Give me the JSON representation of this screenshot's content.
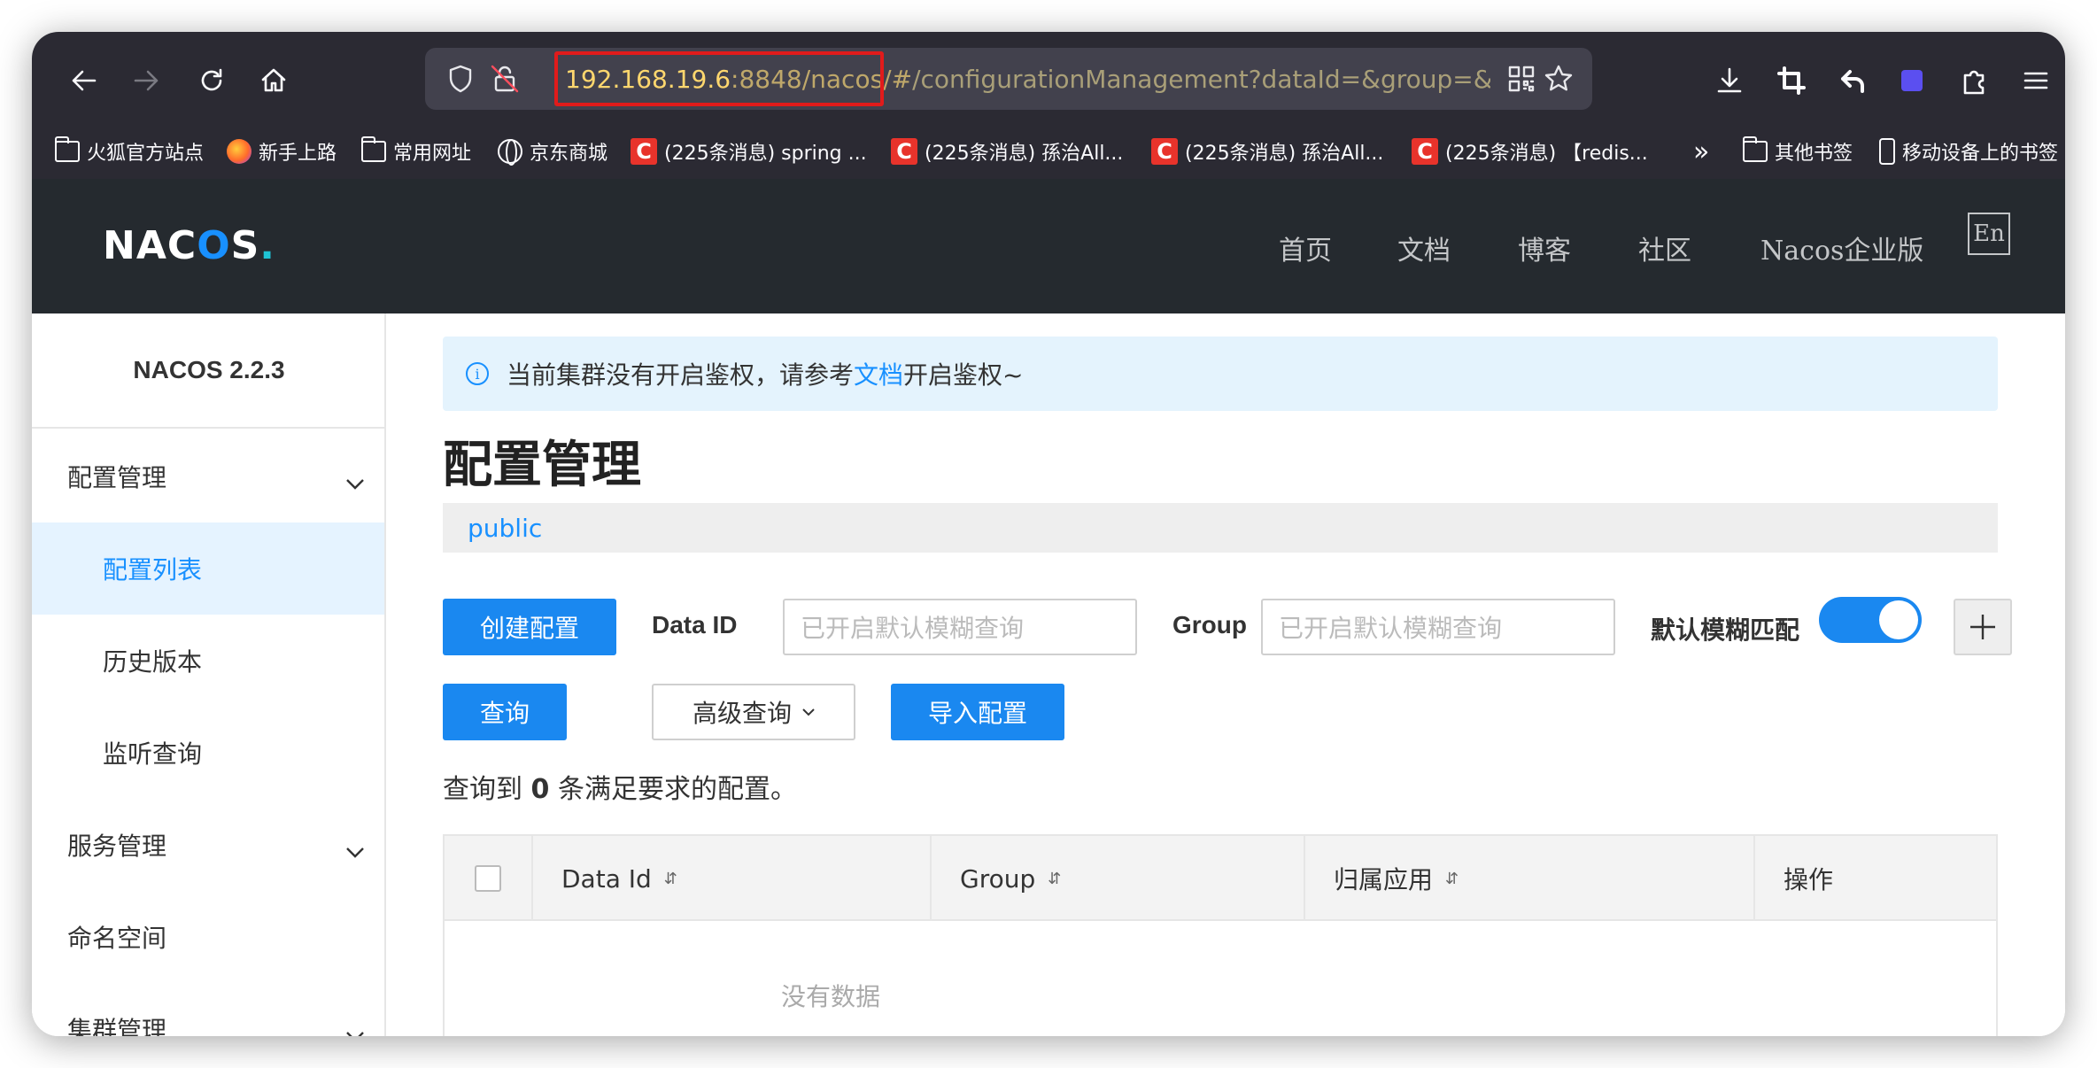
{
  "browser": {
    "url_host": "192.168.19.6",
    "url_port_path": ":8848/nacos/#",
    "url_rest": "/configurationManagement?dataId=&group=&appNam"
  },
  "bookmarks": [
    {
      "label": "火狐官方站点",
      "icon": "folder-icon"
    },
    {
      "label": "新手上路",
      "icon": "firefox-icon"
    },
    {
      "label": "常用网址",
      "icon": "folder-icon"
    },
    {
      "label": "京东商城",
      "icon": "globe-icon"
    },
    {
      "label": "(225条消息) spring ...",
      "icon": "csdn-icon"
    },
    {
      "label": "(225条消息) 孫治All...",
      "icon": "csdn-icon"
    },
    {
      "label": "(225条消息) 孫治All...",
      "icon": "csdn-icon"
    },
    {
      "label": "(225条消息) 【redis...",
      "icon": "csdn-icon"
    }
  ],
  "bookmarks_more": "»",
  "bookmarks_right": [
    {
      "label": "其他书签",
      "icon": "folder-icon"
    },
    {
      "label": "移动设备上的书签",
      "icon": "phone-icon"
    }
  ],
  "header": {
    "logo": {
      "n": "N",
      "a": "A",
      "c": "C",
      "o": "O",
      "s": "S",
      "dot": "."
    },
    "nav": [
      "首页",
      "文档",
      "博客",
      "社区",
      "Nacos企业版"
    ],
    "lang": "En"
  },
  "sidebar": {
    "version": "NACOS 2.2.3",
    "items": [
      {
        "label": "配置管理",
        "type": "group"
      },
      {
        "label": "配置列表",
        "type": "sub",
        "active": true
      },
      {
        "label": "历史版本",
        "type": "sub"
      },
      {
        "label": "监听查询",
        "type": "sub"
      },
      {
        "label": "服务管理",
        "type": "group"
      },
      {
        "label": "命名空间",
        "type": "item"
      },
      {
        "label": "集群管理",
        "type": "group"
      }
    ]
  },
  "main": {
    "notice_prefix": "当前集群没有开启鉴权，请参考",
    "notice_link": "文档",
    "notice_suffix": "开启鉴权~",
    "title": "配置管理",
    "namespace": "public",
    "create_button": "创建配置",
    "dataid_label": "Data ID",
    "dataid_placeholder": "已开启默认模糊查询",
    "group_label": "Group",
    "group_placeholder": "已开启默认模糊查询",
    "fuzzy_label": "默认模糊匹配",
    "fuzzy_enabled": true,
    "query_button": "查询",
    "advanced_button": "高级查询",
    "import_button": "导入配置",
    "result_prefix": "查询到",
    "result_count": "0",
    "result_suffix": "条满足要求的配置。",
    "table": {
      "columns": [
        "Data Id",
        "Group",
        "归属应用",
        "操作"
      ],
      "sort_symbol": "⇵",
      "empty_text": "没有数据"
    }
  }
}
